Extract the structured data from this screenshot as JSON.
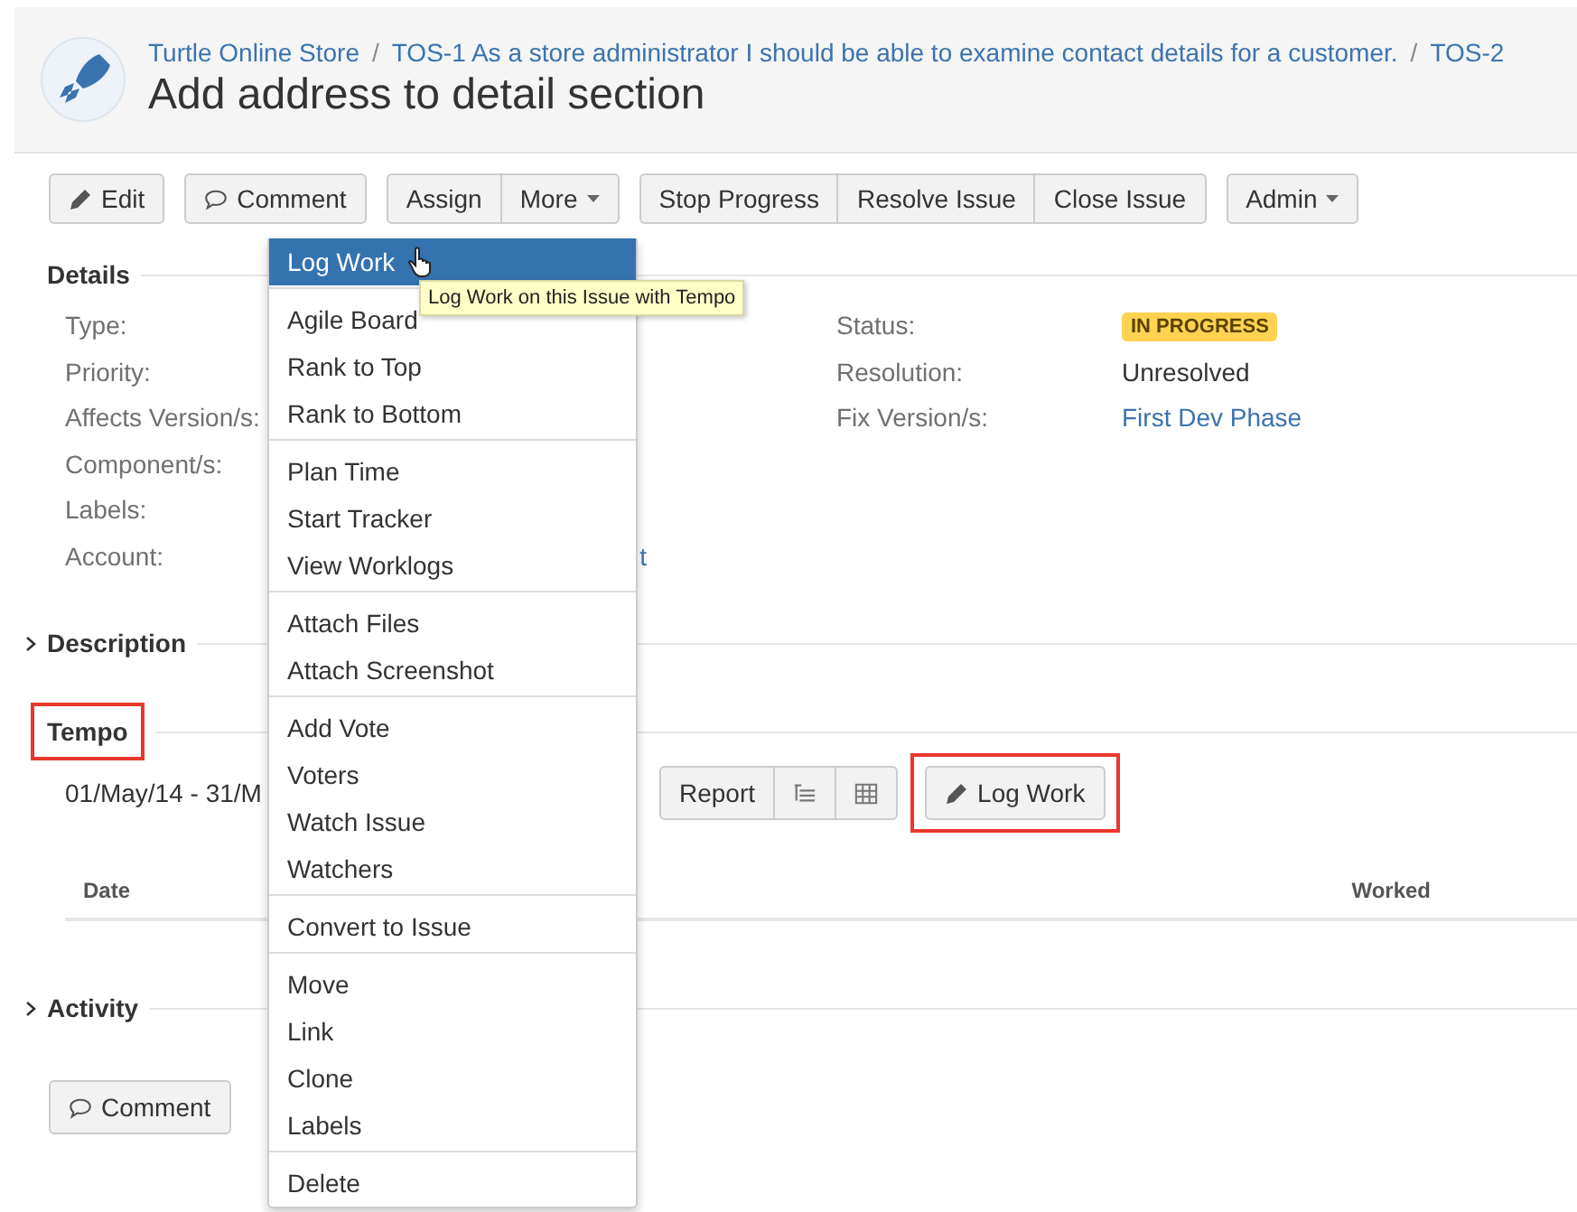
{
  "breadcrumbs": {
    "separator": "/",
    "items": [
      "Turtle Online Store",
      "TOS-1 As a store administrator I should be able to examine contact details for a customer.",
      "TOS-2"
    ]
  },
  "title": "Add address to detail section",
  "toolbar": [
    {
      "buttons": [
        {
          "label": "Edit",
          "kind": "edit"
        }
      ]
    },
    {
      "buttons": [
        {
          "label": "Comment",
          "kind": "comment"
        }
      ]
    },
    {
      "buttons": [
        {
          "label": "Assign",
          "kind": "plain"
        },
        {
          "label": "More",
          "kind": "dropdown"
        }
      ]
    },
    {
      "buttons": [
        {
          "label": "Stop Progress",
          "kind": "plain"
        },
        {
          "label": "Resolve Issue",
          "kind": "plain"
        },
        {
          "label": "Close Issue",
          "kind": "plain"
        }
      ]
    },
    {
      "buttons": [
        {
          "label": "Admin",
          "kind": "dropdown"
        }
      ]
    }
  ],
  "details": {
    "heading": "Details",
    "left": [
      {
        "label": "Type:"
      },
      {
        "label": "Priority:"
      },
      {
        "label": "Affects Version/s:"
      },
      {
        "label": "Component/s:"
      },
      {
        "label": "Labels:"
      },
      {
        "label": "Account:",
        "value": "t",
        "kind": "link"
      }
    ],
    "right": [
      {
        "label": "Status:",
        "value": "IN PROGRESS",
        "kind": "lozenge"
      },
      {
        "label": "Resolution:",
        "value": "Unresolved",
        "kind": "text"
      },
      {
        "label": "Fix Version/s:",
        "value": "First Dev Phase",
        "kind": "link"
      }
    ]
  },
  "description": {
    "heading": "Description",
    "expanded": false
  },
  "tempo": {
    "heading": "Tempo",
    "highlighted": true,
    "date_range": "01/May/14 - 31/M",
    "view_buttons": [
      {
        "kind": "text",
        "label": "Report"
      },
      {
        "kind": "list"
      },
      {
        "kind": "grid"
      }
    ],
    "log_work": {
      "label": "Log Work",
      "highlighted": true
    },
    "columns": [
      "Date",
      "Worked"
    ]
  },
  "activity": {
    "heading": "Activity",
    "expanded": false
  },
  "comment_button": "Comment",
  "menu": {
    "sections": [
      [
        {
          "label": "Log Work",
          "selected": true
        }
      ],
      [
        {
          "label": "Agile Board",
          "selected": false
        },
        {
          "label": "Rank to Top",
          "selected": false
        },
        {
          "label": "Rank to Bottom",
          "selected": false
        }
      ],
      [
        {
          "label": "Plan Time",
          "selected": false
        },
        {
          "label": "Start Tracker",
          "selected": false
        },
        {
          "label": "View Worklogs",
          "selected": false
        }
      ],
      [
        {
          "label": "Attach Files",
          "selected": false
        },
        {
          "label": "Attach Screenshot",
          "selected": false
        }
      ],
      [
        {
          "label": "Add Vote",
          "selected": false
        },
        {
          "label": "Voters",
          "selected": false
        },
        {
          "label": "Watch Issue",
          "selected": false
        },
        {
          "label": "Watchers",
          "selected": false
        }
      ],
      [
        {
          "label": "Convert to Issue",
          "selected": false
        }
      ],
      [
        {
          "label": "Move",
          "selected": false
        },
        {
          "label": "Link",
          "selected": false
        },
        {
          "label": "Clone",
          "selected": false
        },
        {
          "label": "Labels",
          "selected": false
        }
      ],
      [
        {
          "label": "Delete",
          "selected": false
        }
      ]
    ],
    "tooltip": "Log Work on this Issue with Tempo"
  }
}
